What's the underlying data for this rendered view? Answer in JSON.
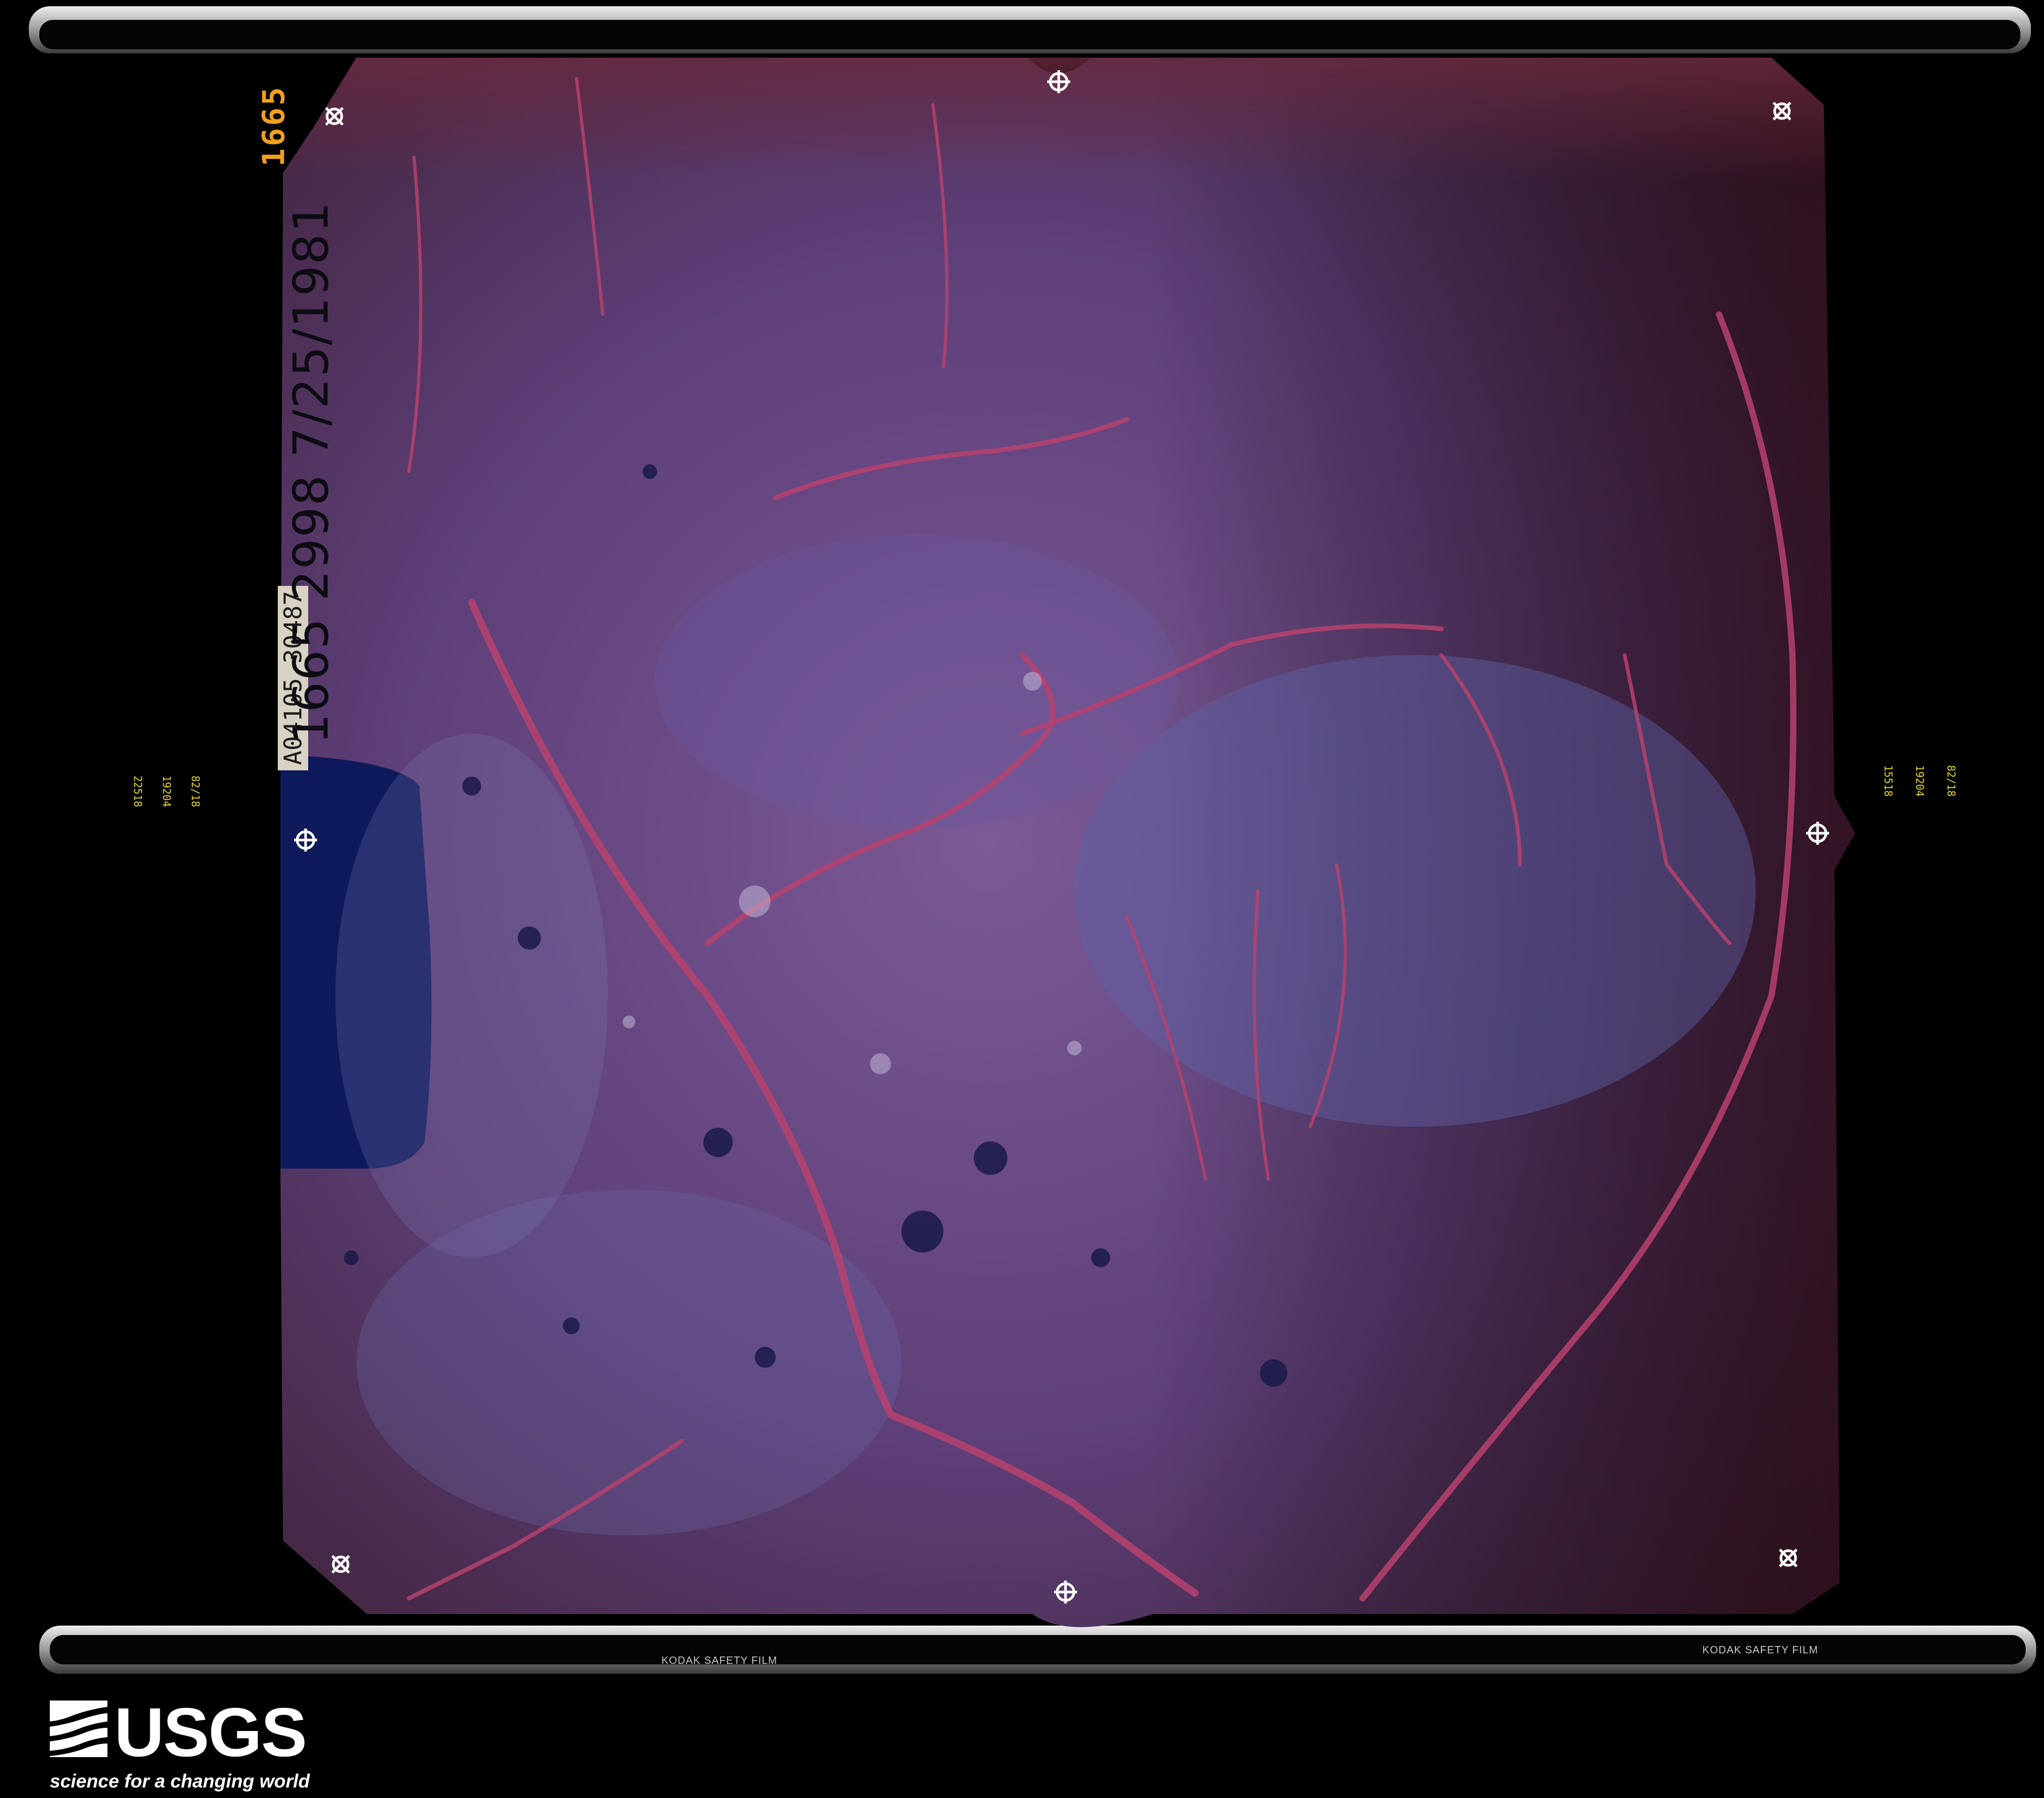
{
  "photo": {
    "frame_number": "1665",
    "roll_annotation": "A04105 30487",
    "handwritten_id": "1665  2998  7/25/1981",
    "side_codes_left": [
      "22518",
      "19204",
      "82/18"
    ],
    "side_codes_right": [
      "15518",
      "19204",
      "82/18"
    ],
    "film_edge_left": "KODAK SAFETY FILM",
    "film_edge_right": "KODAK SAFETY FILM",
    "colors": {
      "terrain_base": "#5a3a70",
      "terrain_blue": "#5d5fa0",
      "drainage_red": "#b04070",
      "water": "#101a5a",
      "background": "#000000"
    }
  },
  "branding": {
    "wordmark": "USGS",
    "tagline": "science for a changing world"
  }
}
